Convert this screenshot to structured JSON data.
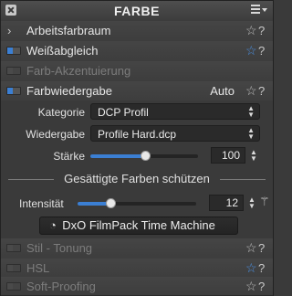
{
  "panel": {
    "title": "FARBE"
  },
  "rows": {
    "arbeitsfarbraum": {
      "label": "Arbeitsfarbraum"
    },
    "weissabgleich": {
      "label": "Weißabgleich"
    },
    "farb_akzentuierung": {
      "label": "Farb-Akzentuierung"
    },
    "farbwiedergabe": {
      "label": "Farbwiedergabe",
      "mode": "Auto"
    },
    "stil_tonung": {
      "label": "Stil - Tonung"
    },
    "hsl": {
      "label": "HSL"
    },
    "soft_proofing": {
      "label": "Soft-Proofing"
    }
  },
  "farbwiedergabe": {
    "kategorie_label": "Kategorie",
    "kategorie_value": "DCP Profil",
    "wiedergabe_label": "Wiedergabe",
    "wiedergabe_value": "Profile Hard.dcp",
    "staerke_label": "Stärke",
    "staerke_value": "100",
    "staerke_level": 1.0,
    "section_title": "Gesättigte Farben schützen",
    "intensitaet_label": "Intensität",
    "intensitaet_value": "12",
    "intensitaet_level": 0.12,
    "button_label": "DxO FilmPack Time Machine"
  },
  "colors": {
    "accent": "#3b7fd3",
    "star_active": "#4a8fe0"
  },
  "icons": {
    "close": "close-icon",
    "menu": "menu-icon",
    "star": "star-icon",
    "reset": "reset-icon",
    "wand": "magic-wand-icon",
    "timer": "timer-icon"
  }
}
